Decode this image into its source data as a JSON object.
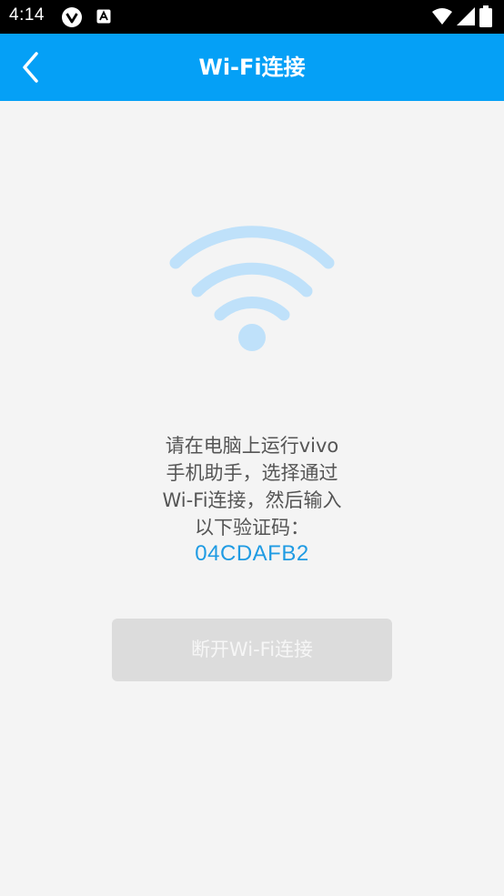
{
  "status_bar": {
    "time": "4:14",
    "icons": [
      "vivo-logo-icon",
      "a-notification-icon",
      "wifi-signal-icon",
      "cell-signal-icon",
      "battery-icon"
    ]
  },
  "app_bar": {
    "title": "Wi-Fi连接",
    "back_icon": "chevron-left-icon",
    "background_color": "#05a0f6"
  },
  "main": {
    "illustration_icon": "wifi-icon",
    "illustration_color": "#bfe1fa",
    "instructions": "请在电脑上运行vivo手机助手，选择通过Wi-Fi连接，然后输入以下验证码：",
    "instruction_lines": [
      "请在电脑上运行vivo",
      "手机助手，选择通过",
      "Wi-Fi连接，然后输入",
      "以下验证码："
    ],
    "verification_code": "04CDAFB2",
    "code_color": "#1f9be3",
    "disconnect_button_label": "断开Wi-Fi连接"
  }
}
